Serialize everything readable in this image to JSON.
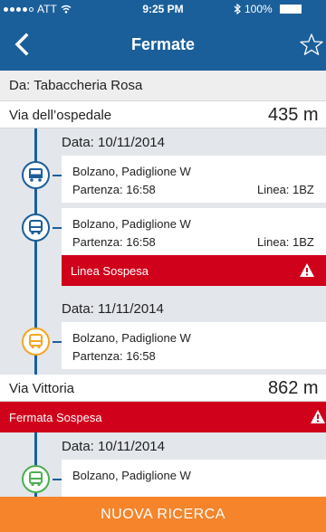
{
  "status": {
    "carrier": "ATT",
    "time": "9:25 PM",
    "battery": "100%"
  },
  "nav": {
    "title": "Fermate"
  },
  "origin": "Da: Tabaccheria Rosa",
  "stops": [
    {
      "name": "Via dell’ospedale",
      "distance": "435 m",
      "groups": [
        {
          "date": "Data: 10/11/2014"
        },
        {
          "date": "Data: 11/11/2014"
        }
      ],
      "departures": [
        {
          "stop": "Bolzano, Padiglione W",
          "departure": "Partenza: 16:58",
          "line": "",
          "icon": "bus-front-icon",
          "color": "#1b5f9a"
        },
        {
          "stop": "Bolzano, Padiglione W",
          "departure": "Partenza: 16:58",
          "line": "Linea: 1BZ",
          "icon": "bus-icon",
          "color": "#1b5f9a"
        },
        {
          "stop": "Bolzano, Padiglione W",
          "departure": "Partenza: 16:58",
          "line": "",
          "icon": "bus-icon",
          "color": "#f5a623"
        }
      ],
      "line_alert": "Linea Sospesa"
    },
    {
      "name": "Via Vittoria",
      "distance": "862 m",
      "stop_alert": "Fermata Sospesa",
      "groups": [
        {
          "date": "Data: 10/11/2014"
        }
      ],
      "departures": [
        {
          "stop": "Bolzano, Padiglione W",
          "icon": "bus-icon",
          "color": "#4caf50"
        }
      ]
    }
  ],
  "first_card_line": "Linea: 1BZ",
  "cta": "NUOVA RICERCA",
  "colors": {
    "primary": "#1b5f9a",
    "alert": "#d0021b",
    "cta": "#f5842a"
  }
}
